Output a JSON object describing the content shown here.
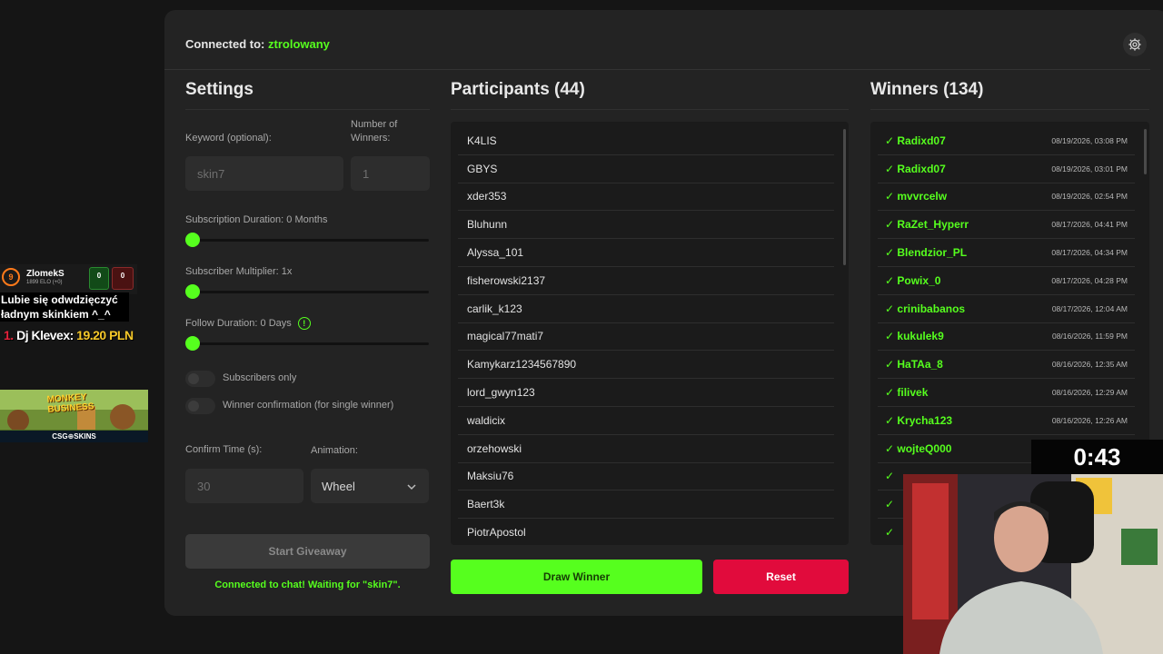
{
  "header": {
    "connected_label": "Connected to:",
    "channel": "ztrolowany"
  },
  "settings": {
    "title": "Settings",
    "keyword_label": "Keyword (optional):",
    "keyword_value": "skin7",
    "winners_label": "Number of Winners:",
    "winners_value": "1",
    "sub_duration_label": "Subscription Duration: 0 Months",
    "sub_multiplier_label": "Subscriber Multiplier: 1x",
    "follow_duration_label": "Follow Duration:  0  Days",
    "subscribers_only_label": "Subscribers only",
    "winner_confirmation_label": "Winner confirmation (for single winner)",
    "confirm_time_label": "Confirm Time (s):",
    "confirm_time_value": "30",
    "animation_label": "Animation:",
    "animation_value": "Wheel",
    "start_label": "Start Giveaway",
    "status_text": "Connected to chat! Waiting for \"skin7\"."
  },
  "participants": {
    "title": "Participants (44)",
    "items": [
      "K4LIS",
      "GBYS",
      "xder353",
      "Bluhunn",
      "Alyssa_101",
      "fisherowski2137",
      "carlik_k123",
      "magical77mati7",
      "Kamykarz1234567890",
      "lord_gwyn123",
      "waldicix",
      "orzehowski",
      "Maksiu76",
      "Baert3k",
      "PiotrApostol"
    ]
  },
  "winners": {
    "title": "Winners (134)",
    "items": [
      {
        "name": "✓ Radixd07",
        "date": "08/19/2026, 03:08 PM"
      },
      {
        "name": "✓ Radixd07",
        "date": "08/19/2026, 03:01 PM"
      },
      {
        "name": "✓ mvvrcelw",
        "date": "08/19/2026, 02:54 PM"
      },
      {
        "name": "✓ RaZet_Hyperr",
        "date": "08/17/2026, 04:41 PM"
      },
      {
        "name": "✓ Blendzior_PL",
        "date": "08/17/2026, 04:34 PM"
      },
      {
        "name": "✓ Powix_0",
        "date": "08/17/2026, 04:28 PM"
      },
      {
        "name": "✓ crinibabanos",
        "date": "08/17/2026, 12:04 AM"
      },
      {
        "name": "✓ kukulek9",
        "date": "08/16/2026, 11:59 PM"
      },
      {
        "name": "✓ HaTAa_8",
        "date": "08/16/2026, 12:35 AM"
      },
      {
        "name": "✓ filivek",
        "date": "08/16/2026, 12:29 AM"
      },
      {
        "name": "✓ Krycha123",
        "date": "08/16/2026, 12:26 AM"
      },
      {
        "name": "✓ wojteQ000",
        "date": ""
      }
    ]
  },
  "actions": {
    "draw_label": "Draw Winner",
    "reset_label": "Reset"
  },
  "overlay": {
    "elo_badge": "9",
    "elo_user": "ZlomekS",
    "elo_sub": "1899 ELO (+0)",
    "wins": "0",
    "losses": "0",
    "chat_line1": "Lubie się odwdzięczyć",
    "chat_line2": "ładnym skinkiem ^_^",
    "donor_rank": "1.",
    "donor_name": "Dj Klevex:",
    "donor_amount": "19.20 PLN",
    "banner_title_1": "MONKEY",
    "banner_title_2": "BUSINESS",
    "banner_brand": "CSG⊕SKINS",
    "timer": "0:43"
  },
  "colors": {
    "accent": "#56ff1e",
    "danger": "#e10b3c",
    "panel": "#232323"
  }
}
